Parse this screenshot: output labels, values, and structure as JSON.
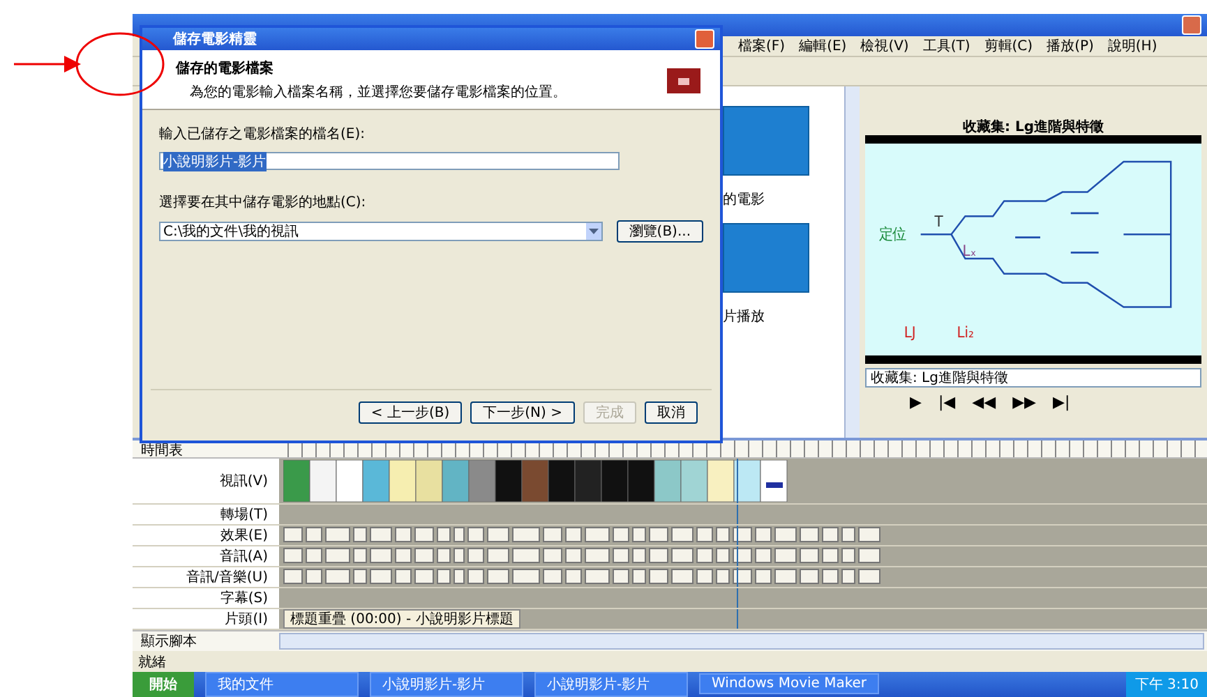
{
  "menu": [
    "檔案(F)",
    "編輯(E)",
    "檢視(V)",
    "工具(T)",
    "剪輯(C)",
    "播放(P)",
    "說明(H)"
  ],
  "dialog": {
    "title": "儲存電影精靈",
    "heading": "儲存的電影檔案",
    "subheading": "為您的電影輸入檔案名稱，並選擇您要儲存電影檔案的位置。",
    "fields": [
      {
        "label": "輸入已儲存之電影檔案的檔名(E):",
        "value": "小說明影片-影片",
        "selected": true,
        "kind": "text"
      },
      {
        "label": "選擇要在其中儲存電影的地點(C):",
        "value": "C:\\我的文件\\我的視訊",
        "kind": "combo",
        "button": "瀏覽(B)..."
      }
    ],
    "buttons": [
      {
        "label": "< 上一步(B)",
        "disabled": false
      },
      {
        "label": "下一步(N) >",
        "disabled": false
      },
      {
        "label": "完成",
        "disabled": true
      },
      {
        "label": "取消",
        "disabled": false
      }
    ]
  },
  "collection": {
    "captions": [
      "的電影",
      "片播放"
    ]
  },
  "preview": {
    "title": "收藏集: Lg進階與特徵",
    "diagram_labels": [
      "定位",
      "T",
      "Lₓ",
      "LJ",
      "Li₂"
    ],
    "seek_text": "收藏集: Lg進階與特徵",
    "controls": [
      "▶",
      "|◀",
      "◀◀",
      "▶▶",
      "▶|"
    ]
  },
  "timeline": {
    "label": "時間表",
    "tracks": [
      {
        "label": "視訊(V)",
        "kind": "video"
      },
      {
        "label": "轉場(T)",
        "kind": "empty"
      },
      {
        "label": "效果(E)",
        "kind": "tiles"
      },
      {
        "label": "音訊(A)",
        "kind": "tiles"
      },
      {
        "label": "音訊/音樂(U)",
        "kind": "tiles"
      },
      {
        "label": "字幕(S)",
        "kind": "empty"
      },
      {
        "label": "片頭(I)",
        "kind": "title",
        "clip": "標題重疊 (00:00) - 小說明影片標題"
      }
    ]
  },
  "storyboard_toggle": "顯示腳本",
  "status": "就緒",
  "taskbar": {
    "start": "開始",
    "items": [
      "我的文件",
      "小說明影片-影片",
      "小說明影片-影片",
      "Windows Movie Maker"
    ],
    "clock": "下午 3:10"
  }
}
